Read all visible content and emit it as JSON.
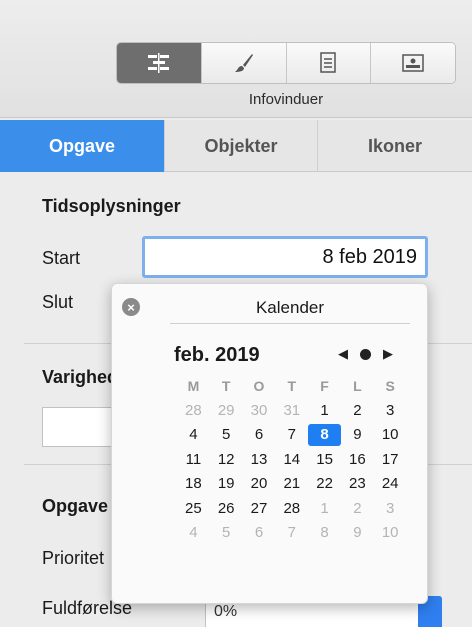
{
  "toolbar": {
    "segments": [
      {
        "name": "gantt-icon",
        "active": true
      },
      {
        "name": "brush-icon",
        "active": false
      },
      {
        "name": "document-icon",
        "active": false
      },
      {
        "name": "picture-icon",
        "active": false
      }
    ],
    "label": "Infovinduer"
  },
  "tabs": [
    {
      "label": "Opgave",
      "active": true
    },
    {
      "label": "Objekter",
      "active": false
    },
    {
      "label": "Ikoner",
      "active": false
    }
  ],
  "panel": {
    "time_section_title": "Tidsoplysninger",
    "start_label": "Start",
    "start_value": "8 feb 2019",
    "end_label": "Slut",
    "duration_title": "Varighed",
    "task_section_title": "Opgave",
    "priority_label": "Prioritet",
    "completion_label": "Fuldførelse",
    "completion_value": "0%"
  },
  "calendar": {
    "title": "Kalender",
    "month_label": "feb. 2019",
    "weekdays": [
      "M",
      "T",
      "O",
      "T",
      "F",
      "L",
      "S"
    ],
    "weeks": [
      [
        {
          "d": "28",
          "o": true
        },
        {
          "d": "29",
          "o": true
        },
        {
          "d": "30",
          "o": true
        },
        {
          "d": "31",
          "o": true
        },
        {
          "d": "1"
        },
        {
          "d": "2"
        },
        {
          "d": "3"
        }
      ],
      [
        {
          "d": "4"
        },
        {
          "d": "5"
        },
        {
          "d": "6"
        },
        {
          "d": "7"
        },
        {
          "d": "8",
          "sel": true
        },
        {
          "d": "9"
        },
        {
          "d": "10"
        }
      ],
      [
        {
          "d": "11"
        },
        {
          "d": "12"
        },
        {
          "d": "13"
        },
        {
          "d": "14"
        },
        {
          "d": "15"
        },
        {
          "d": "16"
        },
        {
          "d": "17"
        }
      ],
      [
        {
          "d": "18"
        },
        {
          "d": "19"
        },
        {
          "d": "20"
        },
        {
          "d": "21"
        },
        {
          "d": "22"
        },
        {
          "d": "23"
        },
        {
          "d": "24"
        }
      ],
      [
        {
          "d": "25"
        },
        {
          "d": "26"
        },
        {
          "d": "27"
        },
        {
          "d": "28"
        },
        {
          "d": "1",
          "o": true
        },
        {
          "d": "2",
          "o": true
        },
        {
          "d": "3",
          "o": true
        }
      ],
      [
        {
          "d": "4",
          "o": true
        },
        {
          "d": "5",
          "o": true
        },
        {
          "d": "6",
          "o": true
        },
        {
          "d": "7",
          "o": true
        },
        {
          "d": "8",
          "o": true
        },
        {
          "d": "9",
          "o": true
        },
        {
          "d": "10",
          "o": true
        }
      ]
    ]
  },
  "colors": {
    "accent": "#3b8fea",
    "selected_day": "#1f7ff2"
  }
}
